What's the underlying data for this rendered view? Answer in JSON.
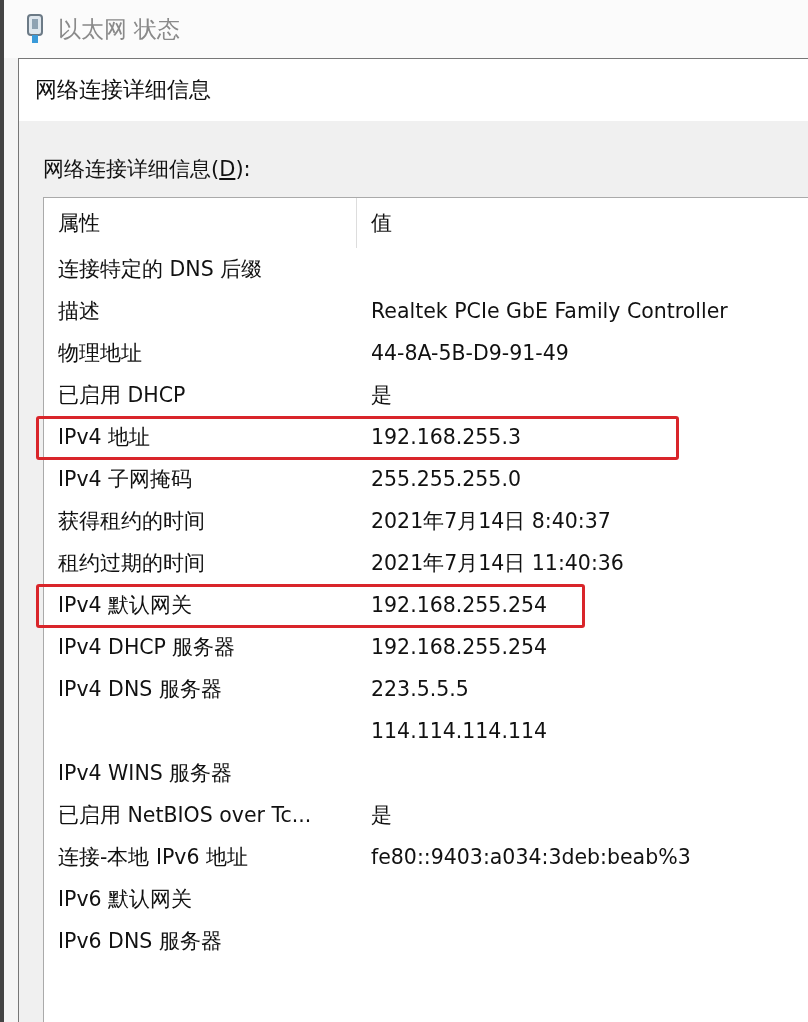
{
  "window": {
    "title": "以太网 状态"
  },
  "dialog": {
    "title": "网络连接详细信息",
    "list_label": {
      "before": "网络连接详细信息(",
      "access_key": "D",
      "after": "):"
    },
    "columns": [
      "属性",
      "值"
    ],
    "rows": [
      {
        "property": "连接特定的 DNS 后缀",
        "value": "",
        "highlighted": false
      },
      {
        "property": "描述",
        "value": "Realtek PCIe GbE Family Controller",
        "highlighted": false
      },
      {
        "property": "物理地址",
        "value": "44-8A-5B-D9-91-49",
        "highlighted": false
      },
      {
        "property": "已启用 DHCP",
        "value": "是",
        "highlighted": false
      },
      {
        "property": "IPv4 地址",
        "value": "192.168.255.3",
        "highlighted": true
      },
      {
        "property": "IPv4 子网掩码",
        "value": "255.255.255.0",
        "highlighted": false
      },
      {
        "property": "获得租约的时间",
        "value": "2021年7月14日 8:40:37",
        "highlighted": false
      },
      {
        "property": "租约过期的时间",
        "value": "2021年7月14日 11:40:36",
        "highlighted": false
      },
      {
        "property": "IPv4 默认网关",
        "value": "192.168.255.254",
        "highlighted": true
      },
      {
        "property": "IPv4 DHCP 服务器",
        "value": "192.168.255.254",
        "highlighted": false
      },
      {
        "property": "IPv4 DNS 服务器",
        "value": "223.5.5.5",
        "highlighted": false
      },
      {
        "property": "",
        "value": "114.114.114.114",
        "highlighted": false
      },
      {
        "property": "IPv4 WINS 服务器",
        "value": "",
        "highlighted": false
      },
      {
        "property": "已启用 NetBIOS over Tc...",
        "value": "是",
        "highlighted": false
      },
      {
        "property": "连接-本地 IPv6 地址",
        "value": "fe80::9403:a034:3deb:beab%3",
        "highlighted": false
      },
      {
        "property": "IPv6 默认网关",
        "value": "",
        "highlighted": false
      },
      {
        "property": "IPv6 DNS 服务器",
        "value": "",
        "highlighted": false
      }
    ]
  }
}
